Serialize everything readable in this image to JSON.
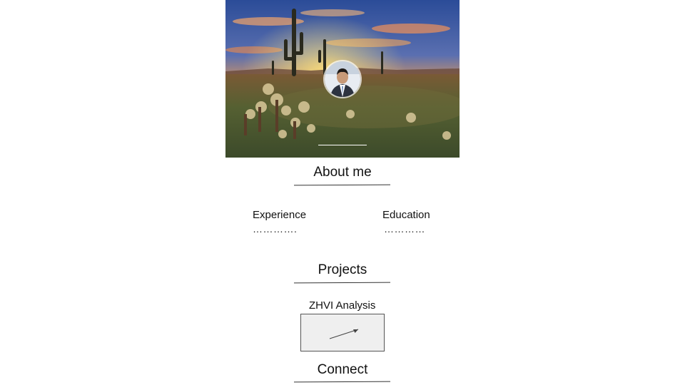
{
  "about": {
    "title": "About me"
  },
  "experience": {
    "label": "Experience",
    "placeholder": "…………."
  },
  "education": {
    "label": "Education",
    "placeholder": "…………"
  },
  "projects": {
    "title": "Projects",
    "items": [
      {
        "title": "ZHVI Analysis"
      }
    ]
  },
  "connect": {
    "title": "Connect"
  },
  "colors": {
    "sky_top": "#2c4f9a",
    "sunset": "#f08a24",
    "ground": "#4a5a34",
    "card_bg": "#efefef"
  },
  "icons": {
    "project_thumbnail": "arrow-icon"
  }
}
